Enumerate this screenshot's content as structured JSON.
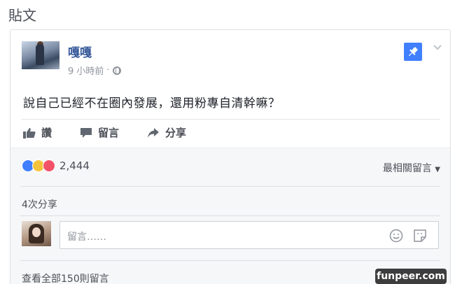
{
  "section": {
    "title": "貼文"
  },
  "post": {
    "author": "嘎嘎",
    "time": "9 小時前",
    "separator": "·",
    "text": "說自己已經不在圈內發展，還用粉專自清幹嘛？"
  },
  "actions": {
    "like_label": "讚",
    "comment_label": "留言",
    "share_label": "分享"
  },
  "reactions": {
    "count": "2,444",
    "types": [
      "like",
      "haha",
      "love"
    ]
  },
  "sort": {
    "label": "最相關留言",
    "caret": "▼"
  },
  "shares": {
    "label": "4次分享"
  },
  "comment_box": {
    "placeholder": "留言……"
  },
  "view_all": {
    "label": "查看全部150則留言"
  },
  "watermark": {
    "label": "funpeer.com"
  },
  "colors": {
    "link_blue": "#365899",
    "accent_blue": "#4080ff",
    "muted": "#90949c",
    "text": "#1d2129",
    "haha_yellow": "#f5c33b",
    "love_red": "#f25268"
  }
}
